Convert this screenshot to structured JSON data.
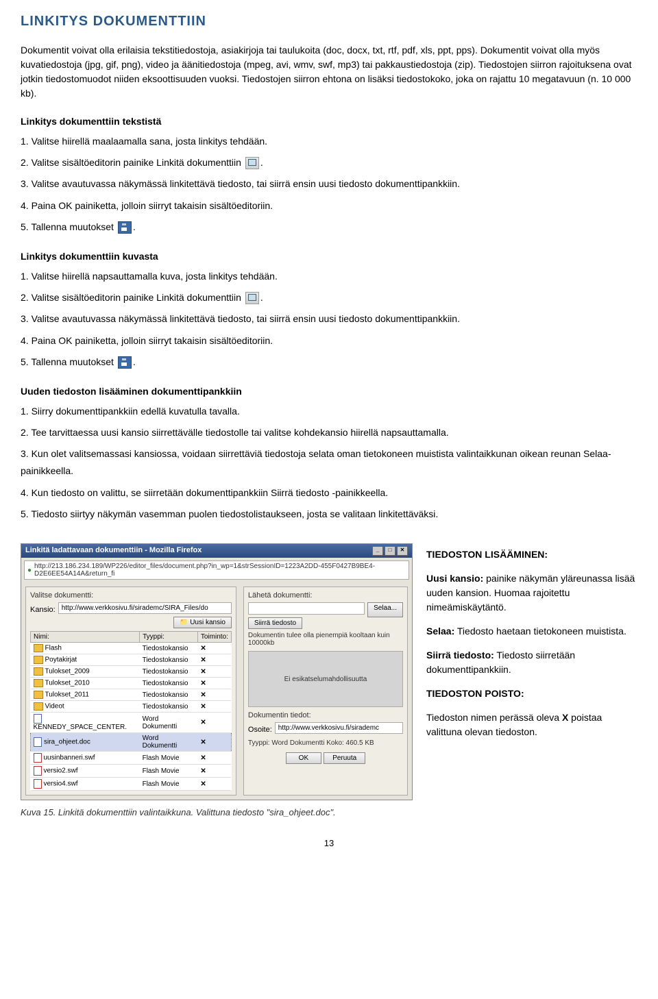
{
  "title": "LINKITYS DOKUMENTTIIN",
  "intro": "Dokumentit voivat olla erilaisia tekstitiedostoja, asiakirjoja tai taulukoita (doc, docx, txt, rtf, pdf, xls, ppt, pps). Dokumentit voivat olla myös kuvatiedostoja (jpg, gif, png), video ja äänitiedostoja (mpeg, avi, wmv, swf, mp3) tai pakkaustiedostoja (zip). Tiedostojen siirron rajoituksena ovat jotkin tiedostomuodot niiden eksoottisuuden vuoksi. Tiedostojen siirron ehtona on lisäksi tiedostokoko, joka on rajattu 10 megatavuun (n. 10 000 kb).",
  "sectionA": {
    "heading": "Linkitys dokumenttiin tekstistä",
    "s1": "1. Valitse hiirellä maalaamalla sana, josta linkitys tehdään.",
    "s2a": "2. Valitse sisältöeditorin painike Linkitä dokumenttiin ",
    "s2b": ".",
    "s3": "3. Valitse avautuvassa näkymässä linkitettävä tiedosto, tai siirrä ensin uusi tiedosto dokumenttipankkiin.",
    "s4": "4. Paina OK painiketta, jolloin siirryt takaisin sisältöeditoriin.",
    "s5a": "5. Tallenna muutokset ",
    "s5b": "."
  },
  "sectionB": {
    "heading": "Linkitys dokumenttiin kuvasta",
    "s1": "1. Valitse hiirellä napsauttamalla kuva, josta linkitys tehdään.",
    "s2a": "2. Valitse sisältöeditorin painike Linkitä dokumenttiin ",
    "s2b": ".",
    "s3": "3. Valitse avautuvassa näkymässä linkitettävä tiedosto, tai siirrä ensin uusi tiedosto dokumenttipankkiin.",
    "s4": "4. Paina OK painiketta, jolloin siirryt takaisin sisältöeditoriin.",
    "s5a": "5. Tallenna muutokset ",
    "s5b": "."
  },
  "sectionC": {
    "heading": "Uuden tiedoston lisääminen dokumenttipankkiin",
    "s1": "1. Siirry dokumenttipankkiin edellä kuvatulla tavalla.",
    "s2": "2. Tee tarvittaessa uusi kansio siirrettävälle tiedostolle tai valitse kohdekansio hiirellä napsauttamalla.",
    "s3": "3. Kun olet valitsemassasi kansiossa, voidaan siirrettäviä tiedostoja selata oman tietokoneen muistista valintaikkunan oikean reunan Selaa-painikkeella.",
    "s4": "4. Kun tiedosto on valittu, se siirretään dokumenttipankkiin Siirrä tiedosto -painikkeella.",
    "s5": "5. Tiedosto siirtyy näkymän vasemman puolen tiedostolistaukseen, josta se valitaan linkitettäväksi."
  },
  "dialog": {
    "title": "Linkitä ladattavaan dokumenttiin - Mozilla Firefox",
    "url": "http://213.186.234.189/WP226/editor_files/document.php?in_wp=1&strSessionID=1223A2DD-455F0427B9BE4-D2E6EE54A14A&return_fi",
    "leftLabel": "Valitse dokumentti:",
    "kansioLabel": "Kansio:",
    "kansioValue": "http://www.verkkosivu.fi/sirademc/SIRA_Files/do",
    "uusiKansio": "Uusi kansio",
    "tableHeaders": {
      "nimi": "Nimi:",
      "tyyppi": "Tyyppi:",
      "toiminto": "Toiminto:"
    },
    "rows": [
      {
        "icon": "folder",
        "name": "Flash",
        "type": "Tiedostokansio",
        "action": "✕"
      },
      {
        "icon": "folder",
        "name": "Poytakirjat",
        "type": "Tiedostokansio",
        "action": "✕"
      },
      {
        "icon": "folder",
        "name": "Tulokset_2009",
        "type": "Tiedostokansio",
        "action": "✕"
      },
      {
        "icon": "folder",
        "name": "Tulokset_2010",
        "type": "Tiedostokansio",
        "action": "✕"
      },
      {
        "icon": "folder",
        "name": "Tulokset_2011",
        "type": "Tiedostokansio",
        "action": "✕"
      },
      {
        "icon": "folder",
        "name": "Videot",
        "type": "Tiedostokansio",
        "action": "✕"
      },
      {
        "icon": "doc",
        "name": "KENNEDY_SPACE_CENTER.",
        "type": "Word Dokumentti",
        "action": "✕"
      },
      {
        "icon": "doc",
        "name": "sira_ohjeet.doc",
        "type": "Word Dokumentti",
        "action": "✕",
        "selected": true
      },
      {
        "icon": "swf",
        "name": "uusinbanneri.swf",
        "type": "Flash Movie",
        "action": "✕"
      },
      {
        "icon": "swf",
        "name": "versio2.swf",
        "type": "Flash Movie",
        "action": "✕"
      },
      {
        "icon": "swf",
        "name": "versio4.swf",
        "type": "Flash Movie",
        "action": "✕"
      }
    ],
    "rightLabel": "Lähetä dokumentti:",
    "selaa": "Selaa...",
    "siirra": "Siirrä tiedosto",
    "sizeNote": "Dokumentin tulee olla pienempiä kooltaan kuin 10000kb",
    "noPreview": "Ei esikatselumahdollisuutta",
    "tiedotLabel": "Dokumentin tiedot:",
    "osoiteLabel": "Osoite:",
    "osoiteValue": "http://www.verkkosivu.fi/sirademc",
    "tyyppiKoko": "Tyyppi: Word Dokumentti  Koko: 460.5 KB",
    "ok": "OK",
    "peruuta": "Peruuta"
  },
  "sidebar": {
    "h1": "TIEDOSTON LISÄÄMINEN:",
    "uusi_b": "Uusi kansio:",
    "uusi_t": " painike näkymän yläreunassa lisää uuden kansion. Huomaa rajoitettu nimeämiskäytäntö.",
    "selaa_b": "Selaa:",
    "selaa_t": " Tiedosto haetaan tietokoneen muistista.",
    "siirra_b": "Siirrä tiedosto:",
    "siirra_t": " Tiedosto siirretään dokumenttipankkiin.",
    "h2": "TIEDOSTON POISTO:",
    "poisto1": "Tiedoston nimen perässä oleva ",
    "poisto_x": "X",
    "poisto2": " poistaa valittuna olevan tiedoston."
  },
  "caption": "Kuva 15. Linkitä dokumenttiin valintaikkuna. Valittuna tiedosto \"sira_ohjeet.doc\".",
  "pageNum": "13"
}
